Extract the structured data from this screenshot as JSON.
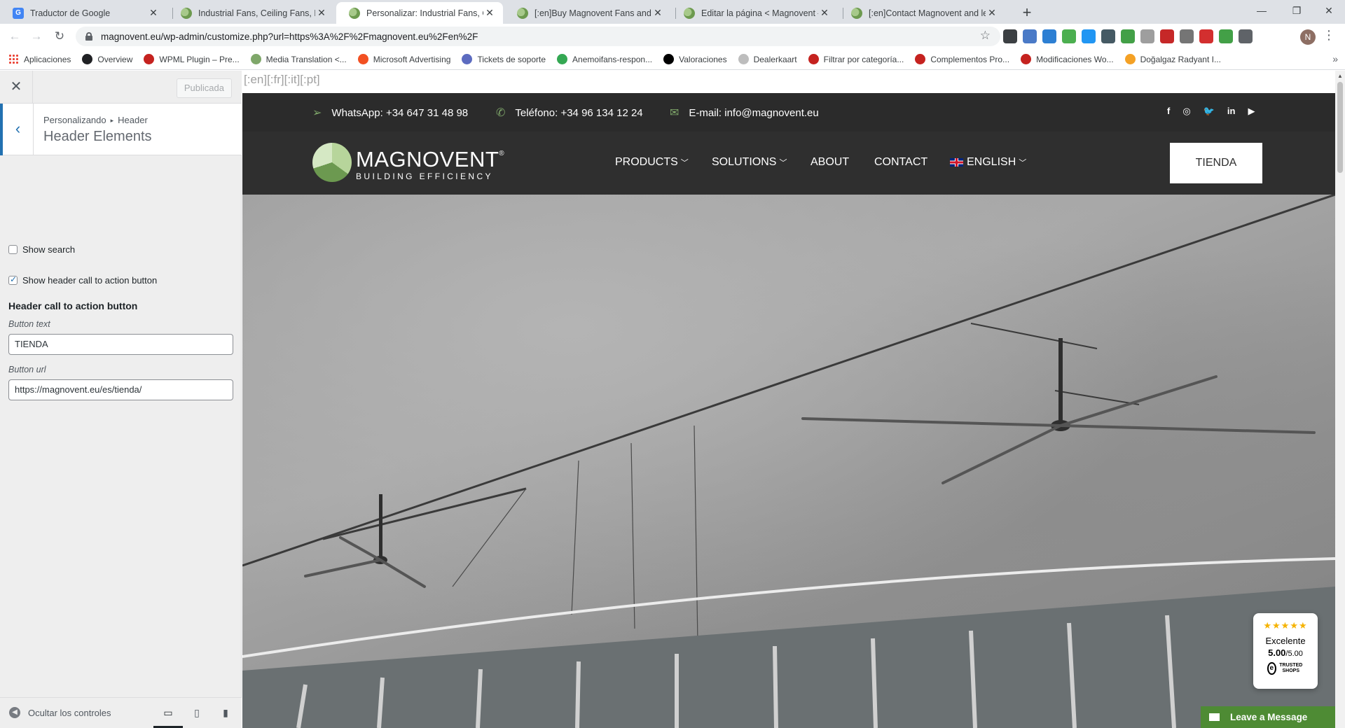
{
  "browser": {
    "tabs": [
      {
        "title": "Traductor de Google",
        "active": false
      },
      {
        "title": "Industrial Fans, Ceiling Fans, Radi",
        "active": false
      },
      {
        "title": "Personalizar: Industrial Fans, Ceili",
        "active": true
      },
      {
        "title": "[:en]Buy Magnovent Fans and He",
        "active": false
      },
      {
        "title": "Editar la página < Magnovent —",
        "active": false
      },
      {
        "title": "[:en]Contact Magnovent and let",
        "active": false
      }
    ],
    "new_tab_label": "+",
    "url": "magnovent.eu/wp-admin/customize.php?url=https%3A%2F%2Fmagnovent.eu%2Fen%2F",
    "profile_initial": "N",
    "bookmarks": [
      {
        "label": "Aplicaciones",
        "color": "#ea4335"
      },
      {
        "label": "Overview",
        "color": "#202124"
      },
      {
        "label": "WPML Plugin – Pre...",
        "color": "#c5221f"
      },
      {
        "label": "Media Translation <...",
        "color": "#7fa76a"
      },
      {
        "label": "Microsoft Advertising",
        "color": "#f25022"
      },
      {
        "label": "Tickets de soporte",
        "color": "#5c6bc0"
      },
      {
        "label": "Anemoifans-respon...",
        "color": "#34a853"
      },
      {
        "label": "Valoraciones",
        "color": "#000000"
      },
      {
        "label": "Dealerkaart",
        "color": "#bdbdbd"
      },
      {
        "label": "Filtrar por categoría...",
        "color": "#c5221f"
      },
      {
        "label": "Complementos Pro...",
        "color": "#c5221f"
      },
      {
        "label": "Modificaciones Wo...",
        "color": "#c5221f"
      },
      {
        "label": "Doğalgaz Radyant I...",
        "color": "#f4a125"
      }
    ],
    "extension_colors": [
      "#3c4043",
      "#4a7ac7",
      "#2d7fd3",
      "#4caf50",
      "#2196f3",
      "#455a64",
      "#43a047",
      "#9e9e9e",
      "#c62828",
      "#757575",
      "#d32f2f",
      "#43a047",
      "#5f6368"
    ]
  },
  "customizer": {
    "published_label": "Publicada",
    "breadcrumb_root": "Personalizando",
    "breadcrumb_section": "Header",
    "panel_title": "Header Elements",
    "show_search_label": "Show search",
    "show_search_checked": false,
    "show_cta_label": "Show header call to action button",
    "show_cta_checked": true,
    "cta_heading": "Header call to action button",
    "button_text_label": "Button text",
    "button_text_value": "TIENDA",
    "button_url_label": "Button url",
    "button_url_value": "https://magnovent.eu/es/tienda/",
    "hide_controls_label": "Ocultar los controles"
  },
  "preview": {
    "lang_string": "[:en][:fr][:it][:pt]",
    "whatsapp": "WhatsApp: +34 647 31 48 98",
    "phone": "Teléfono: +34 96 134 12 24",
    "email": "E-mail: info@magnovent.eu",
    "social": [
      "f",
      "◎",
      "🐦",
      "in",
      "▶"
    ],
    "logo_name": "MAGNOVENT",
    "logo_reg": "®",
    "logo_tagline": "BUILDING EFFICIENCY",
    "menu": {
      "products": "PRODUCTS",
      "solutions": "SOLUTIONS",
      "about": "ABOUT",
      "contact": "CONTACT",
      "language": "ENGLISH"
    },
    "cta_button": "TIENDA",
    "review_widget": {
      "stars": "★★★★★",
      "rating_text": "Excelente",
      "score": "5.00",
      "score_max": "/5.00",
      "brand": "TRUSTED SHOPS",
      "brand_mark": "e"
    },
    "chat_label": "Leave a Message"
  }
}
